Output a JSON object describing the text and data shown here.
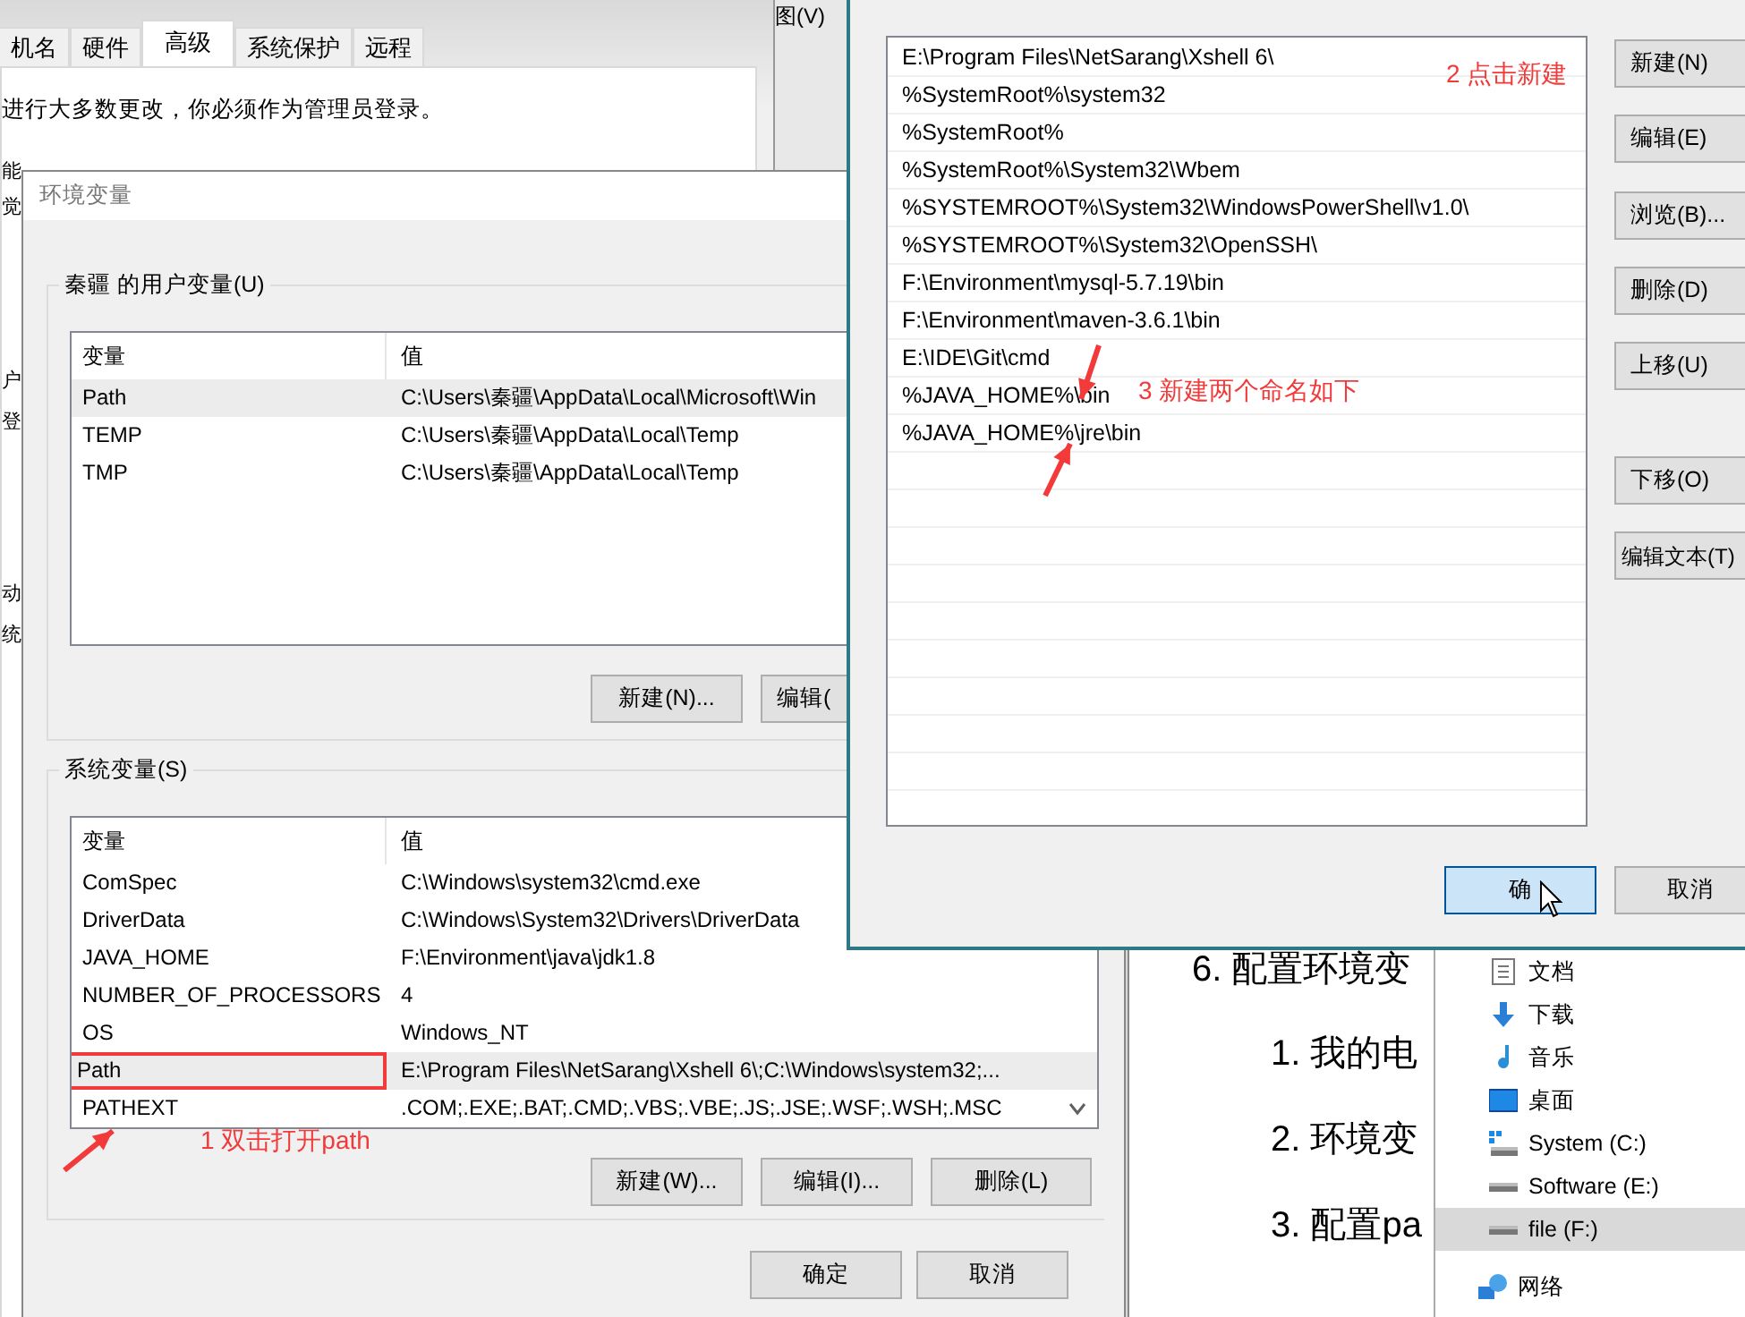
{
  "background_window": {
    "tabs": [
      {
        "label": "机名",
        "selected": false
      },
      {
        "label": "硬件",
        "selected": false
      },
      {
        "label": "高级",
        "selected": true
      },
      {
        "label": "系统保护",
        "selected": false
      },
      {
        "label": "远程",
        "selected": false
      }
    ],
    "notice": "进行大多数更改，你必须作为管理员登录。",
    "fragments": [
      "能",
      "觉",
      "户",
      "登",
      "动",
      "统"
    ]
  },
  "side_window": {
    "menu_fragment": "图(V)"
  },
  "env_dialog": {
    "title": "环境变量",
    "user_group": {
      "label": "秦疆 的用户变量(U)",
      "columns": [
        "变量",
        "值"
      ],
      "rows": [
        {
          "name": "Path",
          "value": "C:\\Users\\秦疆\\AppData\\Local\\Microsoft\\Win",
          "selected": true
        },
        {
          "name": "TEMP",
          "value": "C:\\Users\\秦疆\\AppData\\Local\\Temp",
          "selected": false
        },
        {
          "name": "TMP",
          "value": "C:\\Users\\秦疆\\AppData\\Local\\Temp",
          "selected": false
        }
      ],
      "buttons": [
        "新建(N)...",
        "编辑("
      ]
    },
    "system_group": {
      "label": "系统变量(S)",
      "columns": [
        "变量",
        "值"
      ],
      "rows": [
        {
          "name": "ComSpec",
          "value": "C:\\Windows\\system32\\cmd.exe",
          "selected": false
        },
        {
          "name": "DriverData",
          "value": "C:\\Windows\\System32\\Drivers\\DriverData",
          "selected": false
        },
        {
          "name": "JAVA_HOME",
          "value": "F:\\Environment\\java\\jdk1.8",
          "selected": false
        },
        {
          "name": "NUMBER_OF_PROCESSORS",
          "value": "4",
          "selected": false
        },
        {
          "name": "OS",
          "value": "Windows_NT",
          "selected": false
        },
        {
          "name": "Path",
          "value": "E:\\Program Files\\NetSarang\\Xshell 6\\;C:\\Windows\\system32;...",
          "selected": true,
          "highlighted": true
        },
        {
          "name": "PATHEXT",
          "value": ".COM;.EXE;.BAT;.CMD;.VBS;.VBE;.JS;.JSE;.WSF;.WSH;.MSC",
          "selected": false
        }
      ],
      "buttons": [
        "新建(W)...",
        "编辑(I)...",
        "删除(L)"
      ]
    },
    "buttons": [
      "确定",
      "取消"
    ]
  },
  "path_dialog": {
    "items": [
      "E:\\Program Files\\NetSarang\\Xshell 6\\",
      "%SystemRoot%\\system32",
      "%SystemRoot%",
      "%SystemRoot%\\System32\\Wbem",
      "%SYSTEMROOT%\\System32\\WindowsPowerShell\\v1.0\\",
      "%SYSTEMROOT%\\System32\\OpenSSH\\",
      "F:\\Environment\\mysql-5.7.19\\bin",
      "F:\\Environment\\maven-3.6.1\\bin",
      "E:\\IDE\\Git\\cmd",
      "%JAVA_HOME%\\bin",
      "%JAVA_HOME%\\jre\\bin"
    ],
    "side_buttons": [
      "新建(N)",
      "编辑(E)",
      "浏览(B)...",
      "删除(D)",
      "上移(U)",
      "下移(O)",
      "编辑文本(T)"
    ],
    "buttons": [
      {
        "label": "确",
        "focused": true
      },
      {
        "label": "取消",
        "focused": false
      }
    ]
  },
  "annotations": [
    "1 双击打开path",
    "2 点击新建",
    "3 新建两个命名如下"
  ],
  "document": {
    "heading": "6. 配置环境变",
    "items": [
      "1. 我的电",
      "2. 环境变",
      "3. 配置pa"
    ]
  },
  "explorer_sidebar": {
    "items": [
      {
        "label": "文档",
        "kind": "document",
        "selected": false
      },
      {
        "label": "下载",
        "kind": "download",
        "selected": false
      },
      {
        "label": "音乐",
        "kind": "music",
        "selected": false
      },
      {
        "label": "桌面",
        "kind": "desktop",
        "selected": false
      },
      {
        "label": "System (C:)",
        "kind": "system-drive",
        "selected": false
      },
      {
        "label": "Software (E:)",
        "kind": "drive",
        "selected": false
      },
      {
        "label": "file (F:)",
        "kind": "drive",
        "selected": true
      },
      {
        "label": "网络",
        "kind": "network",
        "selected": false
      }
    ]
  }
}
